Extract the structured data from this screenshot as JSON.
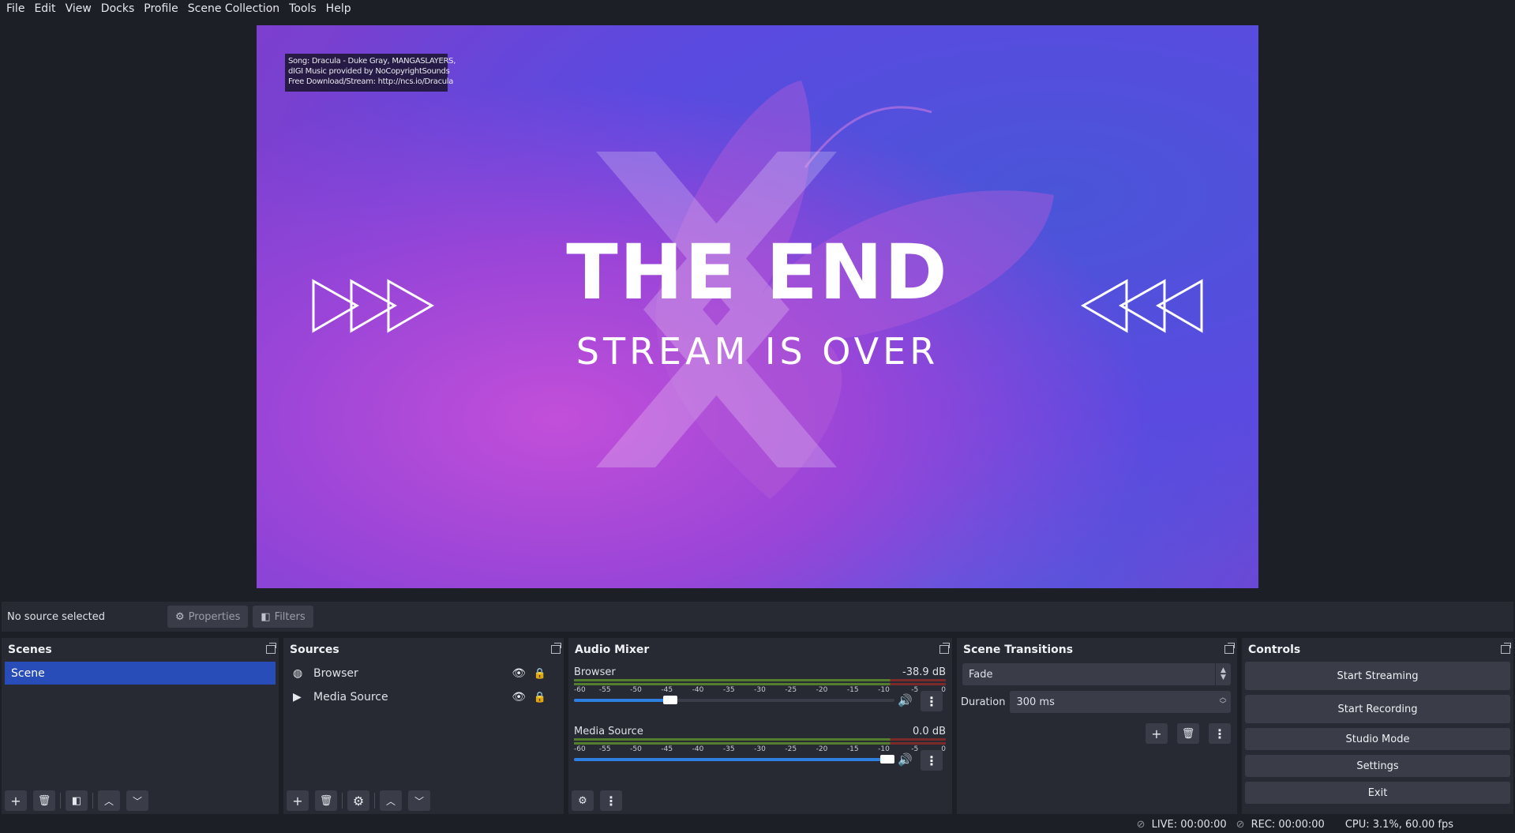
{
  "menu": {
    "file": "File",
    "edit": "Edit",
    "view": "View",
    "docks": "Docks",
    "profile": "Profile",
    "scene_collection": "Scene Collection",
    "tools": "Tools",
    "help": "Help"
  },
  "preview": {
    "credit_lines": [
      "Song: Dracula - Duke Gray, MANGASLAYERS,",
      "dIGI Music provided by NoCopyrightSounds",
      "Free Download/Stream: http://ncs.io/Dracula"
    ],
    "headline": "THE END",
    "subline": "STREAM IS OVER"
  },
  "context_bar": {
    "status": "No source selected",
    "properties": "Properties",
    "filters": "Filters"
  },
  "scenes": {
    "title": "Scenes",
    "items": [
      "Scene"
    ]
  },
  "sources": {
    "title": "Sources",
    "items": [
      {
        "name": "Browser",
        "icon": "globe-icon"
      },
      {
        "name": "Media Source",
        "icon": "play-icon"
      }
    ]
  },
  "audio_mixer": {
    "title": "Audio Mixer",
    "ticks": [
      "-60",
      "-55",
      "-50",
      "-45",
      "-40",
      "-35",
      "-30",
      "-25",
      "-20",
      "-15",
      "-10",
      "-5",
      "0"
    ],
    "channels": [
      {
        "name": "Browser",
        "db": "-38.9 dB",
        "volume": 0.3
      },
      {
        "name": "Media Source",
        "db": "0.0 dB",
        "volume": 1.0
      }
    ]
  },
  "transitions": {
    "title": "Scene Transitions",
    "selected": "Fade",
    "duration_label": "Duration",
    "duration_value": "300 ms"
  },
  "controls": {
    "title": "Controls",
    "start_streaming": "Start Streaming",
    "start_recording": "Start Recording",
    "studio_mode": "Studio Mode",
    "settings": "Settings",
    "exit": "Exit"
  },
  "status_bar": {
    "live": "LIVE: 00:00:00",
    "rec": "REC: 00:00:00",
    "cpu": "CPU: 3.1%, 60.00 fps"
  },
  "colors": {
    "accent": "#284cb8",
    "panel": "#272a33",
    "background": "#1d1f26",
    "button": "#3a3d47",
    "slider": "#2f7fe0"
  }
}
